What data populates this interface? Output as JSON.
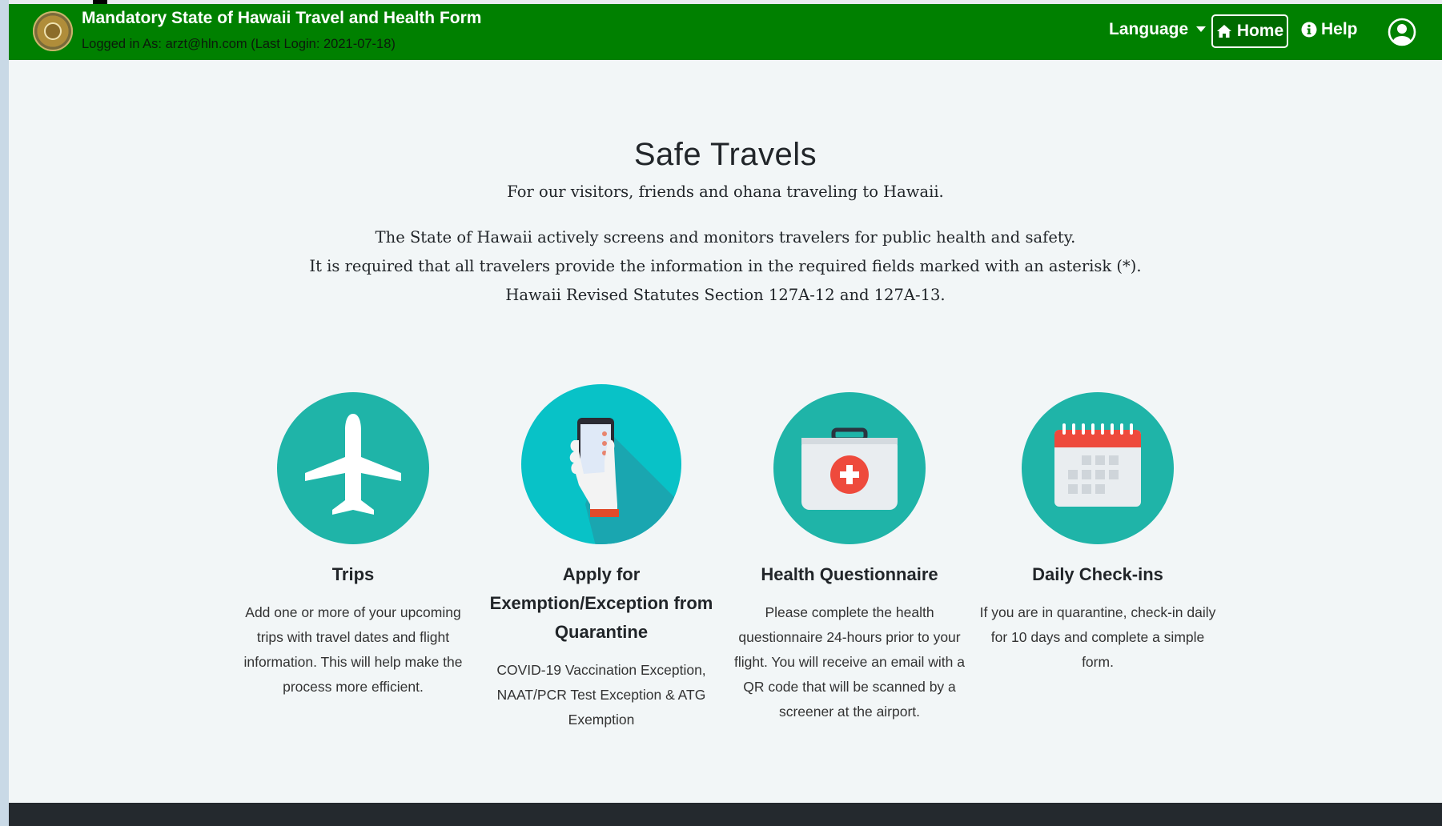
{
  "header": {
    "title": "Mandatory State of Hawaii Travel and Health Form",
    "logged_in": "Logged in As: arzt@hln.com (Last Login: 2021-07-18)",
    "language_label": "Language",
    "home_label": "Home",
    "help_label": "Help",
    "brand_color": "#008000"
  },
  "hero": {
    "title": "Safe Travels",
    "subtitle": "For our visitors, friends and ohana traveling to Hawaii.",
    "lines": [
      "The State of Hawaii actively screens and monitors travelers for public health and safety.",
      "It is required that all travelers provide the information in the required fields marked with an asterisk (*).",
      "Hawaii Revised Statutes Section 127A-12 and 127A-13."
    ]
  },
  "cards": [
    {
      "icon": "airplane-icon",
      "title": "Trips",
      "description": "Add one or more of your upcoming trips with travel dates and flight information. This will help make the process more efficient."
    },
    {
      "icon": "phone-in-hand-icon",
      "title": "Apply for Exemption/Exception from Quarantine",
      "description": "COVID-19 Vaccination Exception, NAAT/PCR Test Exception & ATG Exemption"
    },
    {
      "icon": "first-aid-kit-icon",
      "title": "Health Questionnaire",
      "description": "Please complete the health questionnaire 24-hours prior to your flight. You will receive an email with a QR code that will be scanned by a screener at the airport."
    },
    {
      "icon": "calendar-icon",
      "title": "Daily Check-ins",
      "description": "If you are in quarantine, check-in daily for 10 days and complete a simple form."
    }
  ],
  "colors": {
    "teal_circle": "#1fb4a8",
    "teal_bright": "#08c2c7",
    "footer": "#24292e"
  }
}
